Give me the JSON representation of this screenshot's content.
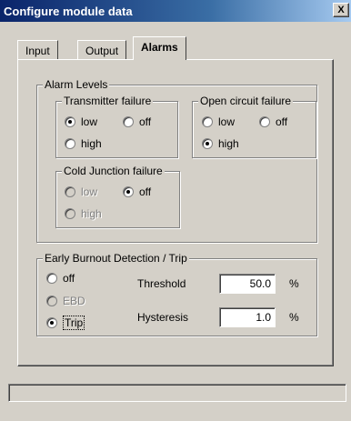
{
  "window": {
    "title": "Configure module data",
    "close_glyph": "X"
  },
  "tabs": [
    {
      "label": "Input"
    },
    {
      "label": "Output"
    },
    {
      "label": "Alarms"
    }
  ],
  "alarm_levels": {
    "legend": "Alarm Levels",
    "transmitter_failure": {
      "legend": "Transmitter failure",
      "options": {
        "low": "low",
        "off": "off",
        "high": "high"
      },
      "selected": "low"
    },
    "open_circuit_failure": {
      "legend": "Open circuit failure",
      "options": {
        "low": "low",
        "off": "off",
        "high": "high"
      },
      "selected": "high"
    },
    "cold_junction_failure": {
      "legend": "Cold Junction failure",
      "options": {
        "low": "low",
        "off": "off",
        "high": "high"
      },
      "selected": "off"
    }
  },
  "burnout": {
    "legend": "Early Burnout Detection / Trip",
    "options": {
      "off": "off",
      "ebd": "EBD",
      "trip": "Trip"
    },
    "selected": "Trip",
    "threshold": {
      "label": "Threshold",
      "value": "50.0",
      "unit": "%"
    },
    "hysteresis": {
      "label": "Hysteresis",
      "value": "1.0",
      "unit": "%"
    }
  },
  "status_bar": {
    "text": ""
  }
}
